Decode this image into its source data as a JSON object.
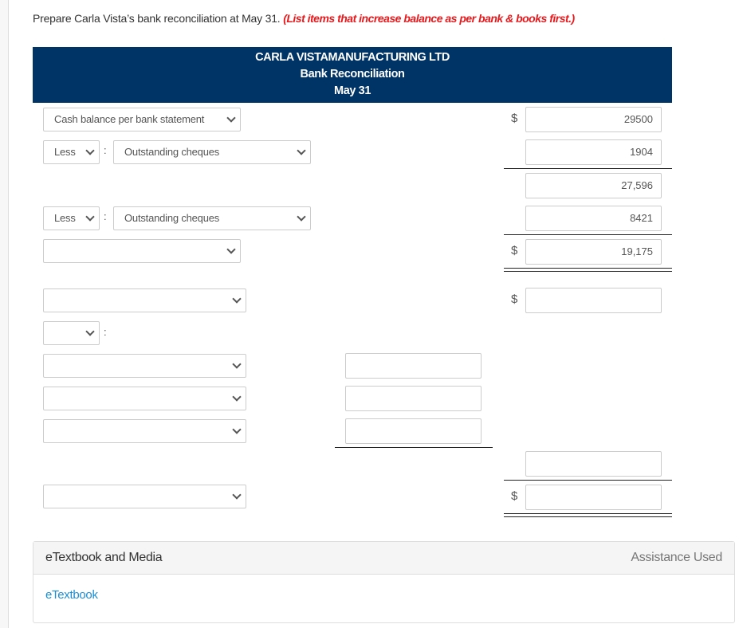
{
  "prompt": {
    "text": "Prepare Carla Vista’s bank reconciliation at May 31.",
    "emphasis": "(List items that increase balance as per bank & books first.)"
  },
  "header": {
    "company": "CARLA VISTAMANUFACTURING LTD",
    "title": "Bank Reconciliation",
    "date": "May 31"
  },
  "rows": {
    "bank_balance": {
      "label": "Cash balance per bank statement",
      "amount": "29500",
      "currency": "$"
    },
    "less1": {
      "operator": "Less",
      "item": "Outstanding cheques",
      "amount": "1904"
    },
    "subtotal1": {
      "amount": "27,596"
    },
    "less2": {
      "operator": "Less",
      "item": "Outstanding cheques",
      "amount": "8421"
    },
    "adjusted_bank": {
      "label": "",
      "amount": "19,175",
      "currency": "$"
    },
    "book_balance": {
      "label": "",
      "amount": "",
      "currency": "$"
    },
    "book_op": {
      "operator": ""
    },
    "book_items": [
      {
        "label": "",
        "amount": ""
      },
      {
        "label": "",
        "amount": ""
      },
      {
        "label": "",
        "amount": ""
      }
    ],
    "book_subtotal": {
      "amount": ""
    },
    "adjusted_book": {
      "label": "",
      "amount": "",
      "currency": "$"
    }
  },
  "footer": {
    "title": "eTextbook and Media",
    "assistance": "Assistance Used",
    "link": "eTextbook"
  },
  "colors": {
    "header_bg": "#003366",
    "emphasis": "#e8191c",
    "link": "#1a8fd6"
  }
}
